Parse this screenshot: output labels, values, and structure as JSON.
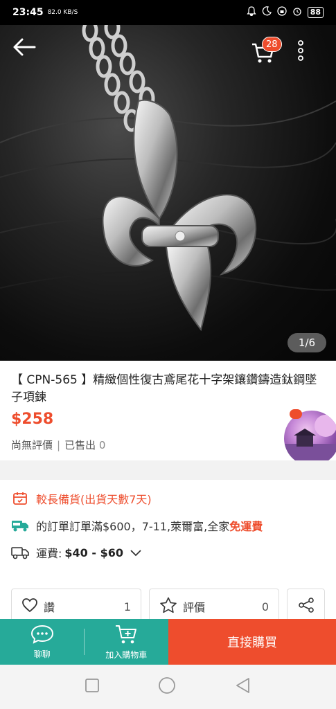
{
  "status_bar": {
    "time": "23:45",
    "network_speed": "82.0 KB/S",
    "battery": "88"
  },
  "gallery": {
    "page_indicator": "1/6",
    "cart_count": "28"
  },
  "product": {
    "title": "【 CPN-565 】精緻個性復古鳶尾花十字架鑲鑽鑄造鈦鋼墜子項鍊",
    "price": "$258",
    "rating_text": "尚無評價",
    "separator": "|",
    "sold_label": "已售出",
    "sold_count": "0"
  },
  "shipping": {
    "preorder": "較長備貨(出貨天數7天)",
    "free_shipping_text": "的訂單訂單滿$600，7-11,萊爾富,全家",
    "free_shipping_highlight": "免運費",
    "fee_label": "運費:",
    "fee_range": "$40 - $60"
  },
  "actions": {
    "like_label": "讚",
    "like_count": "1",
    "review_label": "評價",
    "review_count": "0"
  },
  "bottom_bar": {
    "chat_label": "聊聊",
    "add_to_cart_label": "加入購物車",
    "buy_now_label": "直接購買"
  },
  "colors": {
    "accent": "#ee4d2d",
    "teal": "#26aa99"
  }
}
